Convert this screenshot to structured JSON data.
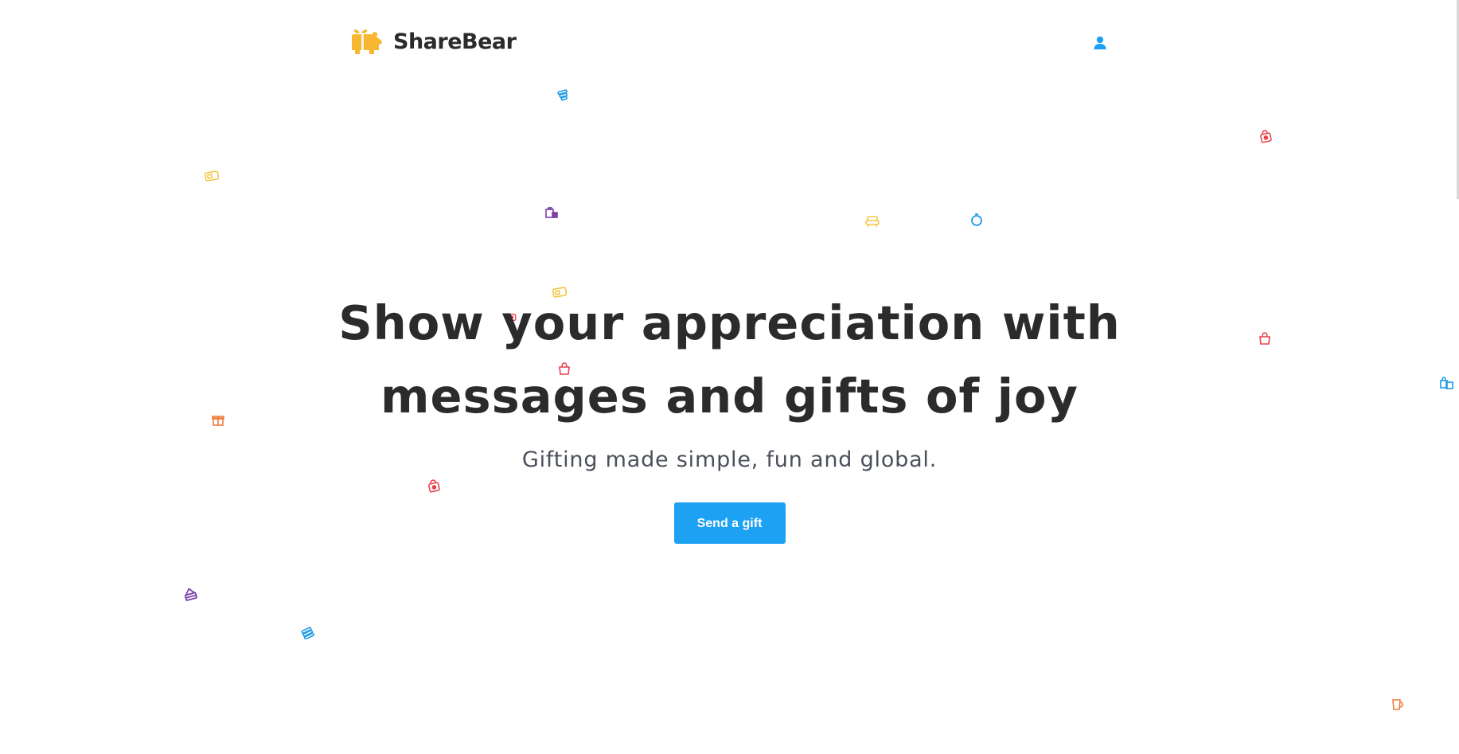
{
  "header": {
    "brand_name": "ShareBear",
    "account_icon": "user-icon"
  },
  "hero": {
    "title_line1": "Show your appreciation with",
    "title_line2": "messages and gifts of joy",
    "subtitle": "Gifting made simple, fun and global.",
    "cta_label": "Send a gift"
  },
  "colors": {
    "brand_yellow": "#f7b733",
    "accent_blue": "#1da1f2",
    "text_dark": "#2b2b2d",
    "confetti_red": "#e8434f",
    "confetti_purple": "#7a3fa8",
    "confetti_orange": "#f07a3c",
    "confetti_blue": "#1f9be6",
    "confetti_yellow": "#f5c542"
  },
  "confetti_icons": [
    "cake-icon",
    "gift-card-icon",
    "gift-bag-icon",
    "ring-icon",
    "sofa-icon",
    "shopping-bag-icon",
    "gift-box-icon",
    "cup-icon",
    "bags-icon"
  ]
}
